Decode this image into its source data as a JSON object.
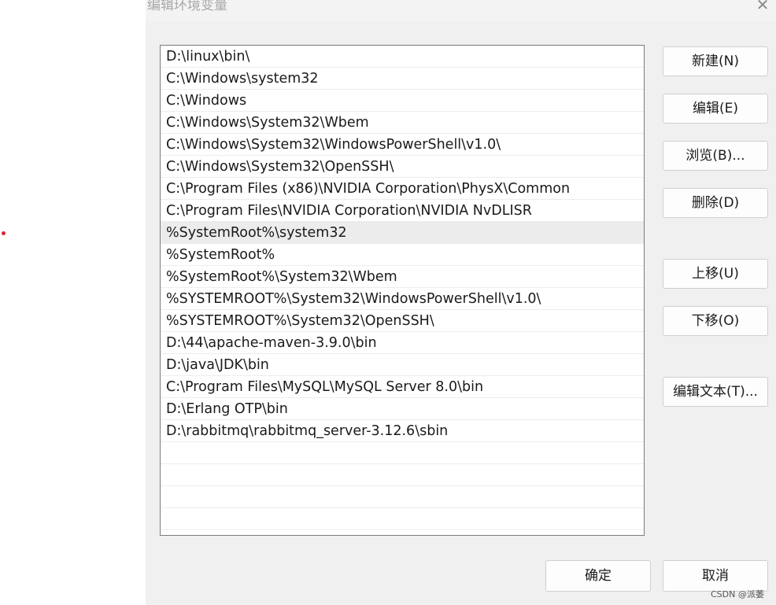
{
  "dialog": {
    "title": "编辑环境变量"
  },
  "paths": [
    "D:\\linux\\bin\\",
    "C:\\Windows\\system32",
    "C:\\Windows",
    "C:\\Windows\\System32\\Wbem",
    "C:\\Windows\\System32\\WindowsPowerShell\\v1.0\\",
    "C:\\Windows\\System32\\OpenSSH\\",
    "C:\\Program Files (x86)\\NVIDIA Corporation\\PhysX\\Common",
    "C:\\Program Files\\NVIDIA Corporation\\NVIDIA NvDLISR",
    "%SystemRoot%\\system32",
    "%SystemRoot%",
    "%SystemRoot%\\System32\\Wbem",
    "%SYSTEMROOT%\\System32\\WindowsPowerShell\\v1.0\\",
    "%SYSTEMROOT%\\System32\\OpenSSH\\",
    "D:\\44\\apache-maven-3.9.0\\bin",
    "D:\\java\\JDK\\bin",
    "C:\\Program Files\\MySQL\\MySQL Server 8.0\\bin",
    "D:\\Erlang OTP\\bin",
    "D:\\rabbitmq\\rabbitmq_server-3.12.6\\sbin"
  ],
  "selected_index": 8,
  "buttons": {
    "new": "新建(N)",
    "edit": "编辑(E)",
    "browse": "浏览(B)...",
    "delete": "删除(D)",
    "move_up": "上移(U)",
    "move_down": "下移(O)",
    "edit_text": "编辑文本(T)...",
    "ok": "确定",
    "cancel": "取消"
  },
  "watermark": "CSDN @派萎"
}
